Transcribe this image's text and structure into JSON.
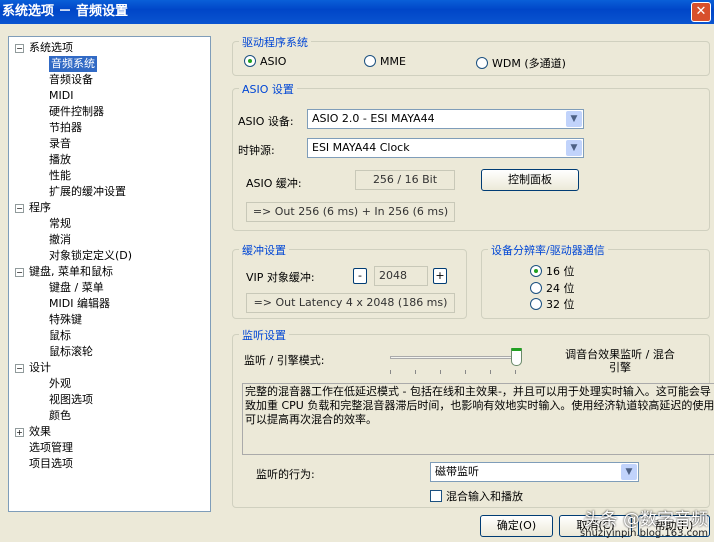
{
  "title": "系统选项 － 音频设置",
  "tree": [
    {
      "label": "系统选项",
      "level": 0,
      "expander": "−"
    },
    {
      "label": "音频系统",
      "level": 1,
      "selected": true
    },
    {
      "label": "音频设备",
      "level": 1
    },
    {
      "label": "MIDI",
      "level": 1
    },
    {
      "label": "硬件控制器",
      "level": 1
    },
    {
      "label": "节拍器",
      "level": 1
    },
    {
      "label": "录音",
      "level": 1
    },
    {
      "label": "播放",
      "level": 1
    },
    {
      "label": "性能",
      "level": 1
    },
    {
      "label": "扩展的缓冲设置",
      "level": 1
    },
    {
      "label": "程序",
      "level": 0,
      "expander": "−"
    },
    {
      "label": "常规",
      "level": 1
    },
    {
      "label": "撤消",
      "level": 1
    },
    {
      "label": "对象锁定定义(D)",
      "level": 1
    },
    {
      "label": "键盘, 菜单和鼠标",
      "level": 0,
      "expander": "−"
    },
    {
      "label": "键盘 / 菜单",
      "level": 1
    },
    {
      "label": "MIDI 编辑器",
      "level": 1
    },
    {
      "label": "特殊键",
      "level": 1
    },
    {
      "label": "鼠标",
      "level": 1
    },
    {
      "label": "鼠标滚轮",
      "level": 1
    },
    {
      "label": "设计",
      "level": 0,
      "expander": "−"
    },
    {
      "label": "外观",
      "level": 1
    },
    {
      "label": "视图选项",
      "level": 1
    },
    {
      "label": "颜色",
      "level": 1
    },
    {
      "label": "效果",
      "level": 0,
      "expander": "+"
    },
    {
      "label": "选项管理",
      "level": 0
    },
    {
      "label": "项目选项",
      "level": 0
    }
  ],
  "driver": {
    "title": "驱动程序系统",
    "options": [
      "ASIO",
      "MME",
      "WDM (多通道)"
    ],
    "selected": "ASIO"
  },
  "asio": {
    "title": "ASIO 设置",
    "device_label": "ASIO 设备:",
    "device": "ASIO 2.0 - ESI MAYA44",
    "clock_label": "时钟源:",
    "clock": "ESI MAYA44 Clock",
    "buffer_label": "ASIO 缓冲:",
    "buffer": "256 / 16 Bit",
    "control_panel": "控制面板",
    "latency": "=> Out 256 (6 ms) + In 256 (6 ms)"
  },
  "buffer": {
    "title": "缓冲设置",
    "vip_label": "VIP 对象缓冲:",
    "minus": "-",
    "value": "2048",
    "plus": "+",
    "latency": "=> Out Latency 4 x 2048 (186 ms)"
  },
  "resolution": {
    "title": "设备分辨率/驱动器通信",
    "options": [
      "16 位",
      "24 位",
      "32 位"
    ],
    "selected": "16 位"
  },
  "monitor": {
    "title": "监听设置",
    "mode_label": "监听 / 引擎模式:",
    "slider_position": "6/6",
    "mode_value": "调音台效果监听 / 混合引擎",
    "description": "完整的混音器工作在低延迟模式 - 包括在线和主效果-，并且可以用于处理实时输入。这可能会导致加重 CPU 负载和完整混音器滞后时间，也影响有效地实时输入。使用经济轨道较高延迟的使用可以提高再次混合的效率。",
    "behavior_label": "监听的行为:",
    "behavior": "磁带监听",
    "mix_label": "混合输入和播放",
    "mix_checked": false
  },
  "buttons": {
    "ok": "确定(O)",
    "cancel": "取消(C)",
    "help": "帮助(H)"
  },
  "watermark": {
    "text": "头条 @数字音频",
    "url": "shuziyinpin.blog.163.com"
  }
}
